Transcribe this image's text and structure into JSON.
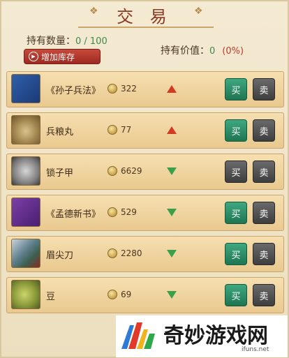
{
  "header": {
    "title": "交 易",
    "hold_count_label": "持有数量：",
    "hold_count_value": "0 / 100",
    "hold_value_label": "持有价值：",
    "hold_value_value": "0",
    "hold_value_pct": "(0%)",
    "add_stock_label": "增加库存"
  },
  "items": [
    {
      "name": "《孙子兵法》",
      "price": "322",
      "trend": "up",
      "buy_enabled": true
    },
    {
      "name": "兵粮丸",
      "price": "77",
      "trend": "up",
      "buy_enabled": true
    },
    {
      "name": "锁子甲",
      "price": "6629",
      "trend": "down",
      "buy_enabled": false
    },
    {
      "name": "《孟德新书》",
      "price": "529",
      "trend": "down",
      "buy_enabled": true
    },
    {
      "name": "眉尖刀",
      "price": "2280",
      "trend": "down",
      "buy_enabled": true
    },
    {
      "name": "豆",
      "price": "69",
      "trend": "down",
      "buy_enabled": true
    }
  ],
  "buttons": {
    "buy": "买",
    "sell": "卖"
  },
  "watermark": {
    "text": "奇妙游戏网",
    "url": "ifuns.net"
  },
  "colors": {
    "buy_active": "#2a8c64",
    "sell": "#4a4a4a",
    "trend_up": "#d23a22",
    "trend_down": "#3aa04a"
  }
}
